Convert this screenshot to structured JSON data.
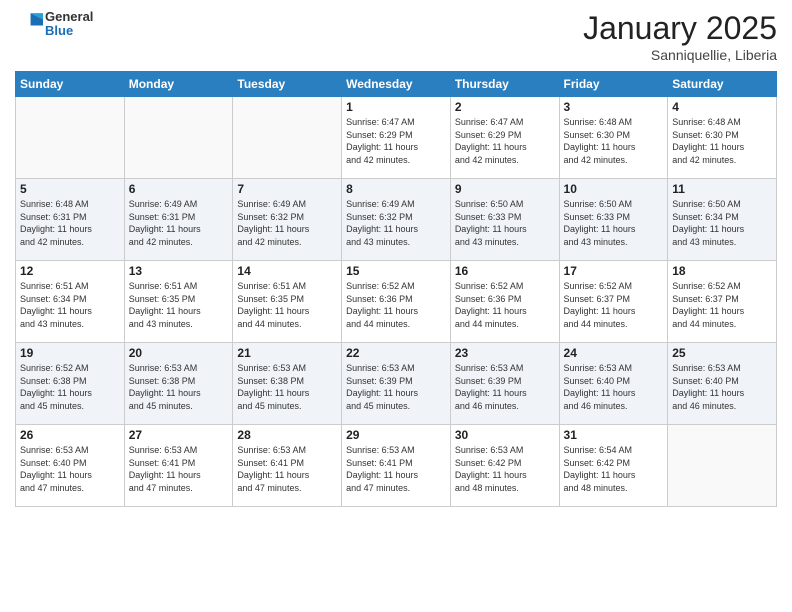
{
  "header": {
    "logo_general": "General",
    "logo_blue": "Blue",
    "month_title": "January 2025",
    "location": "Sanniquellie, Liberia"
  },
  "weekdays": [
    "Sunday",
    "Monday",
    "Tuesday",
    "Wednesday",
    "Thursday",
    "Friday",
    "Saturday"
  ],
  "weeks": [
    [
      {
        "day": "",
        "info": ""
      },
      {
        "day": "",
        "info": ""
      },
      {
        "day": "",
        "info": ""
      },
      {
        "day": "1",
        "info": "Sunrise: 6:47 AM\nSunset: 6:29 PM\nDaylight: 11 hours\nand 42 minutes."
      },
      {
        "day": "2",
        "info": "Sunrise: 6:47 AM\nSunset: 6:29 PM\nDaylight: 11 hours\nand 42 minutes."
      },
      {
        "day": "3",
        "info": "Sunrise: 6:48 AM\nSunset: 6:30 PM\nDaylight: 11 hours\nand 42 minutes."
      },
      {
        "day": "4",
        "info": "Sunrise: 6:48 AM\nSunset: 6:30 PM\nDaylight: 11 hours\nand 42 minutes."
      }
    ],
    [
      {
        "day": "5",
        "info": "Sunrise: 6:48 AM\nSunset: 6:31 PM\nDaylight: 11 hours\nand 42 minutes."
      },
      {
        "day": "6",
        "info": "Sunrise: 6:49 AM\nSunset: 6:31 PM\nDaylight: 11 hours\nand 42 minutes."
      },
      {
        "day": "7",
        "info": "Sunrise: 6:49 AM\nSunset: 6:32 PM\nDaylight: 11 hours\nand 42 minutes."
      },
      {
        "day": "8",
        "info": "Sunrise: 6:49 AM\nSunset: 6:32 PM\nDaylight: 11 hours\nand 43 minutes."
      },
      {
        "day": "9",
        "info": "Sunrise: 6:50 AM\nSunset: 6:33 PM\nDaylight: 11 hours\nand 43 minutes."
      },
      {
        "day": "10",
        "info": "Sunrise: 6:50 AM\nSunset: 6:33 PM\nDaylight: 11 hours\nand 43 minutes."
      },
      {
        "day": "11",
        "info": "Sunrise: 6:50 AM\nSunset: 6:34 PM\nDaylight: 11 hours\nand 43 minutes."
      }
    ],
    [
      {
        "day": "12",
        "info": "Sunrise: 6:51 AM\nSunset: 6:34 PM\nDaylight: 11 hours\nand 43 minutes."
      },
      {
        "day": "13",
        "info": "Sunrise: 6:51 AM\nSunset: 6:35 PM\nDaylight: 11 hours\nand 43 minutes."
      },
      {
        "day": "14",
        "info": "Sunrise: 6:51 AM\nSunset: 6:35 PM\nDaylight: 11 hours\nand 44 minutes."
      },
      {
        "day": "15",
        "info": "Sunrise: 6:52 AM\nSunset: 6:36 PM\nDaylight: 11 hours\nand 44 minutes."
      },
      {
        "day": "16",
        "info": "Sunrise: 6:52 AM\nSunset: 6:36 PM\nDaylight: 11 hours\nand 44 minutes."
      },
      {
        "day": "17",
        "info": "Sunrise: 6:52 AM\nSunset: 6:37 PM\nDaylight: 11 hours\nand 44 minutes."
      },
      {
        "day": "18",
        "info": "Sunrise: 6:52 AM\nSunset: 6:37 PM\nDaylight: 11 hours\nand 44 minutes."
      }
    ],
    [
      {
        "day": "19",
        "info": "Sunrise: 6:52 AM\nSunset: 6:38 PM\nDaylight: 11 hours\nand 45 minutes."
      },
      {
        "day": "20",
        "info": "Sunrise: 6:53 AM\nSunset: 6:38 PM\nDaylight: 11 hours\nand 45 minutes."
      },
      {
        "day": "21",
        "info": "Sunrise: 6:53 AM\nSunset: 6:38 PM\nDaylight: 11 hours\nand 45 minutes."
      },
      {
        "day": "22",
        "info": "Sunrise: 6:53 AM\nSunset: 6:39 PM\nDaylight: 11 hours\nand 45 minutes."
      },
      {
        "day": "23",
        "info": "Sunrise: 6:53 AM\nSunset: 6:39 PM\nDaylight: 11 hours\nand 46 minutes."
      },
      {
        "day": "24",
        "info": "Sunrise: 6:53 AM\nSunset: 6:40 PM\nDaylight: 11 hours\nand 46 minutes."
      },
      {
        "day": "25",
        "info": "Sunrise: 6:53 AM\nSunset: 6:40 PM\nDaylight: 11 hours\nand 46 minutes."
      }
    ],
    [
      {
        "day": "26",
        "info": "Sunrise: 6:53 AM\nSunset: 6:40 PM\nDaylight: 11 hours\nand 47 minutes."
      },
      {
        "day": "27",
        "info": "Sunrise: 6:53 AM\nSunset: 6:41 PM\nDaylight: 11 hours\nand 47 minutes."
      },
      {
        "day": "28",
        "info": "Sunrise: 6:53 AM\nSunset: 6:41 PM\nDaylight: 11 hours\nand 47 minutes."
      },
      {
        "day": "29",
        "info": "Sunrise: 6:53 AM\nSunset: 6:41 PM\nDaylight: 11 hours\nand 47 minutes."
      },
      {
        "day": "30",
        "info": "Sunrise: 6:53 AM\nSunset: 6:42 PM\nDaylight: 11 hours\nand 48 minutes."
      },
      {
        "day": "31",
        "info": "Sunrise: 6:54 AM\nSunset: 6:42 PM\nDaylight: 11 hours\nand 48 minutes."
      },
      {
        "day": "",
        "info": ""
      }
    ]
  ]
}
